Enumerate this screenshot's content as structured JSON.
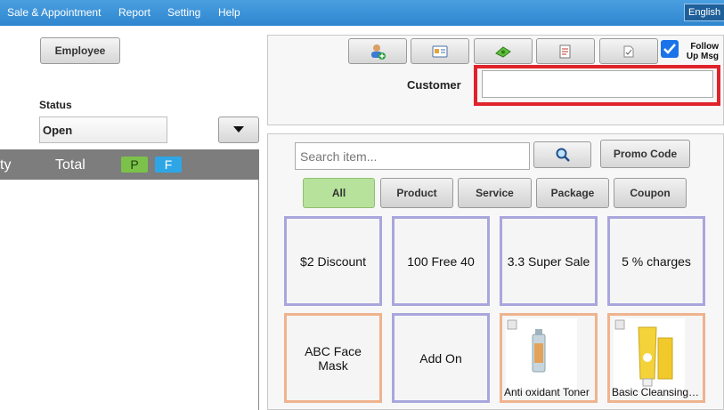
{
  "menu": {
    "items": [
      {
        "label": "Sale & Appointment"
      },
      {
        "label": "Report"
      },
      {
        "label": "Setting"
      },
      {
        "label": "Help"
      }
    ],
    "language": "English"
  },
  "left": {
    "employee_button": "Employee",
    "status_label": "Status",
    "status_value": "Open",
    "table": {
      "col_qty": "ty",
      "col_total": "Total",
      "chip_p": "P",
      "chip_f": "F"
    }
  },
  "right_top": {
    "toolbar_icons": [
      "add-customer-icon",
      "customer-card-icon",
      "payment-icon",
      "notes-icon",
      "document-icon"
    ],
    "follow_up": {
      "line1": "Follow",
      "line2": "Up Msg",
      "checked": true
    },
    "customer_label": "Customer",
    "customer_value": ""
  },
  "catalog": {
    "search_placeholder": "Search item...",
    "promo_button": "Promo Code",
    "tabs": [
      {
        "label": "All",
        "active": true
      },
      {
        "label": "Product",
        "active": false
      },
      {
        "label": "Service",
        "active": false
      },
      {
        "label": "Package",
        "active": false
      },
      {
        "label": "Coupon",
        "active": false
      }
    ],
    "items": [
      {
        "name": "$2 Discount",
        "type": "promo"
      },
      {
        "name": "100 Free 40",
        "type": "promo"
      },
      {
        "name": "3.3 Super Sale",
        "type": "promo"
      },
      {
        "name": "5 % charges",
        "type": "promo"
      },
      {
        "name": "ABC Face Mask",
        "type": "service"
      },
      {
        "name": "Add On",
        "type": "promo"
      },
      {
        "name": "Anti oxidant Toner",
        "type": "product"
      },
      {
        "name": "Basic Cleansing Milk",
        "type": "product"
      }
    ]
  },
  "colors": {
    "menubar": "#2f86cf",
    "promo_border": "#a9a6dd",
    "product_border": "#efb38d",
    "highlight": "#e0232b",
    "tab_active": "#b6e29b"
  }
}
